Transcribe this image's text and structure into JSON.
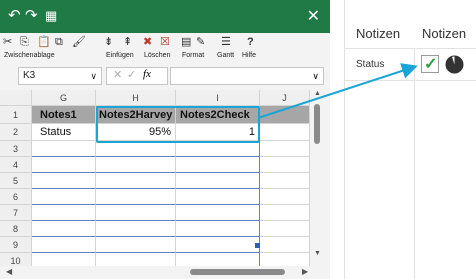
{
  "titlebar": {
    "undo": "↶",
    "redo": "↷",
    "app": "▦",
    "close": "✕"
  },
  "ribbon": {
    "zwischenablage": "Zwischenablage",
    "einfuegen": "Einfügen",
    "loeschen": "Löschen",
    "format": "Format",
    "gantt": "Gantt",
    "hilfe": "Hilfe"
  },
  "formula_bar": {
    "name_box": "K3",
    "fx": "fx",
    "value": ""
  },
  "sheet": {
    "columns": [
      "G",
      "H",
      "I",
      "J"
    ],
    "rows": [
      "1",
      "2",
      "3",
      "4",
      "5",
      "6",
      "7",
      "8",
      "9",
      "10"
    ],
    "header": [
      "Notes1",
      "Notes2Harvey",
      "Notes2Check"
    ],
    "row2": [
      "Status",
      "95%",
      "1"
    ]
  },
  "right_panel": {
    "col1_title": "Notizen",
    "col2_title": "Notizen",
    "status_label": "Status",
    "check_mark": "✓",
    "harvey_fill_percent": 95
  },
  "colors": {
    "excel_green": "#1f7a45",
    "highlight": "#1ba5d6",
    "header_gray": "#a6a6a6",
    "check_green": "#2ea043"
  }
}
